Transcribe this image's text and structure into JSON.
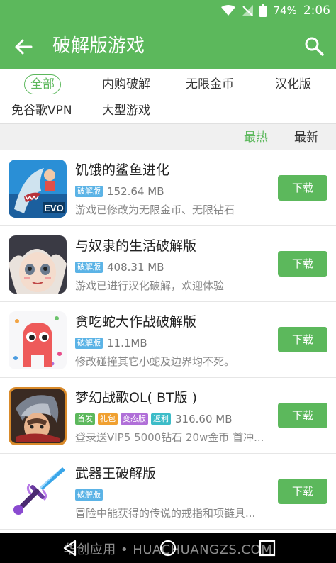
{
  "status_bar": {
    "battery_percent": "74%",
    "time": "2:06"
  },
  "toolbar": {
    "title": "破解版游戏"
  },
  "categories": [
    "全部",
    "内购破解",
    "无限金币",
    "汉化版",
    "免谷歌VPN",
    "大型游戏"
  ],
  "sort": {
    "hot": "最热",
    "newest": "最新"
  },
  "apps": [
    {
      "name": "饥饿的鲨鱼进化",
      "tags": [
        "破解版"
      ],
      "size": "152.64 MB",
      "desc": "游戏已修改为无限金币、无限钻石",
      "button": "下载",
      "thumb_label": "EVO"
    },
    {
      "name": "与奴隶的生活破解版",
      "tags": [
        "破解版"
      ],
      "size": "408.31 MB",
      "desc": "游戏已进行汉化破解，欢迎体验",
      "button": "下载"
    },
    {
      "name": "贪吃蛇大作战破解版",
      "tags": [
        "破解版"
      ],
      "size": "11.1MB",
      "desc": "修改碰撞其它小蛇及边界均不死。",
      "button": "下载"
    },
    {
      "name": "梦幻战歌OL( BT版 )",
      "tags": [
        "首发",
        "礼包",
        "变态版",
        "返利"
      ],
      "size": "316.60 MB",
      "desc": "登录送VIP5 5000钻石 20w金币 首冲...",
      "button": "下载"
    },
    {
      "name": "武器王破解版",
      "tags": [
        "破解版"
      ],
      "size": "",
      "desc": "冒险中能获得的传说的戒指和项链具...",
      "button": "下载"
    }
  ],
  "watermark": "华创应用 • HUACHUANGZS.COM",
  "colors": {
    "accent": "#5cb85c",
    "tag_blue": "#5bb3e6"
  }
}
